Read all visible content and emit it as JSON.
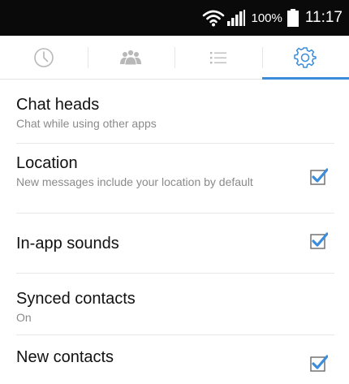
{
  "status_bar": {
    "battery_percent": "100%",
    "time": "11:17"
  },
  "tabs": [
    {
      "icon": "clock-icon",
      "active": false
    },
    {
      "icon": "people-icon",
      "active": false
    },
    {
      "icon": "list-icon",
      "active": false
    },
    {
      "icon": "gear-icon",
      "active": true
    }
  ],
  "settings": {
    "chat_heads": {
      "title": "Chat heads",
      "subtitle": "Chat while using other apps"
    },
    "location": {
      "title": "Location",
      "subtitle": "New messages include your location by default",
      "checked": true
    },
    "in_app_sounds": {
      "title": "In-app sounds",
      "checked": true
    },
    "synced_contacts": {
      "title": "Synced contacts",
      "subtitle": "On"
    },
    "new_contacts": {
      "title": "New contacts",
      "checked": true
    }
  },
  "colors": {
    "accent": "#3b8ddb",
    "inactive_icon": "#b8b8b8",
    "status_bar_bg": "#0a0a0a"
  }
}
